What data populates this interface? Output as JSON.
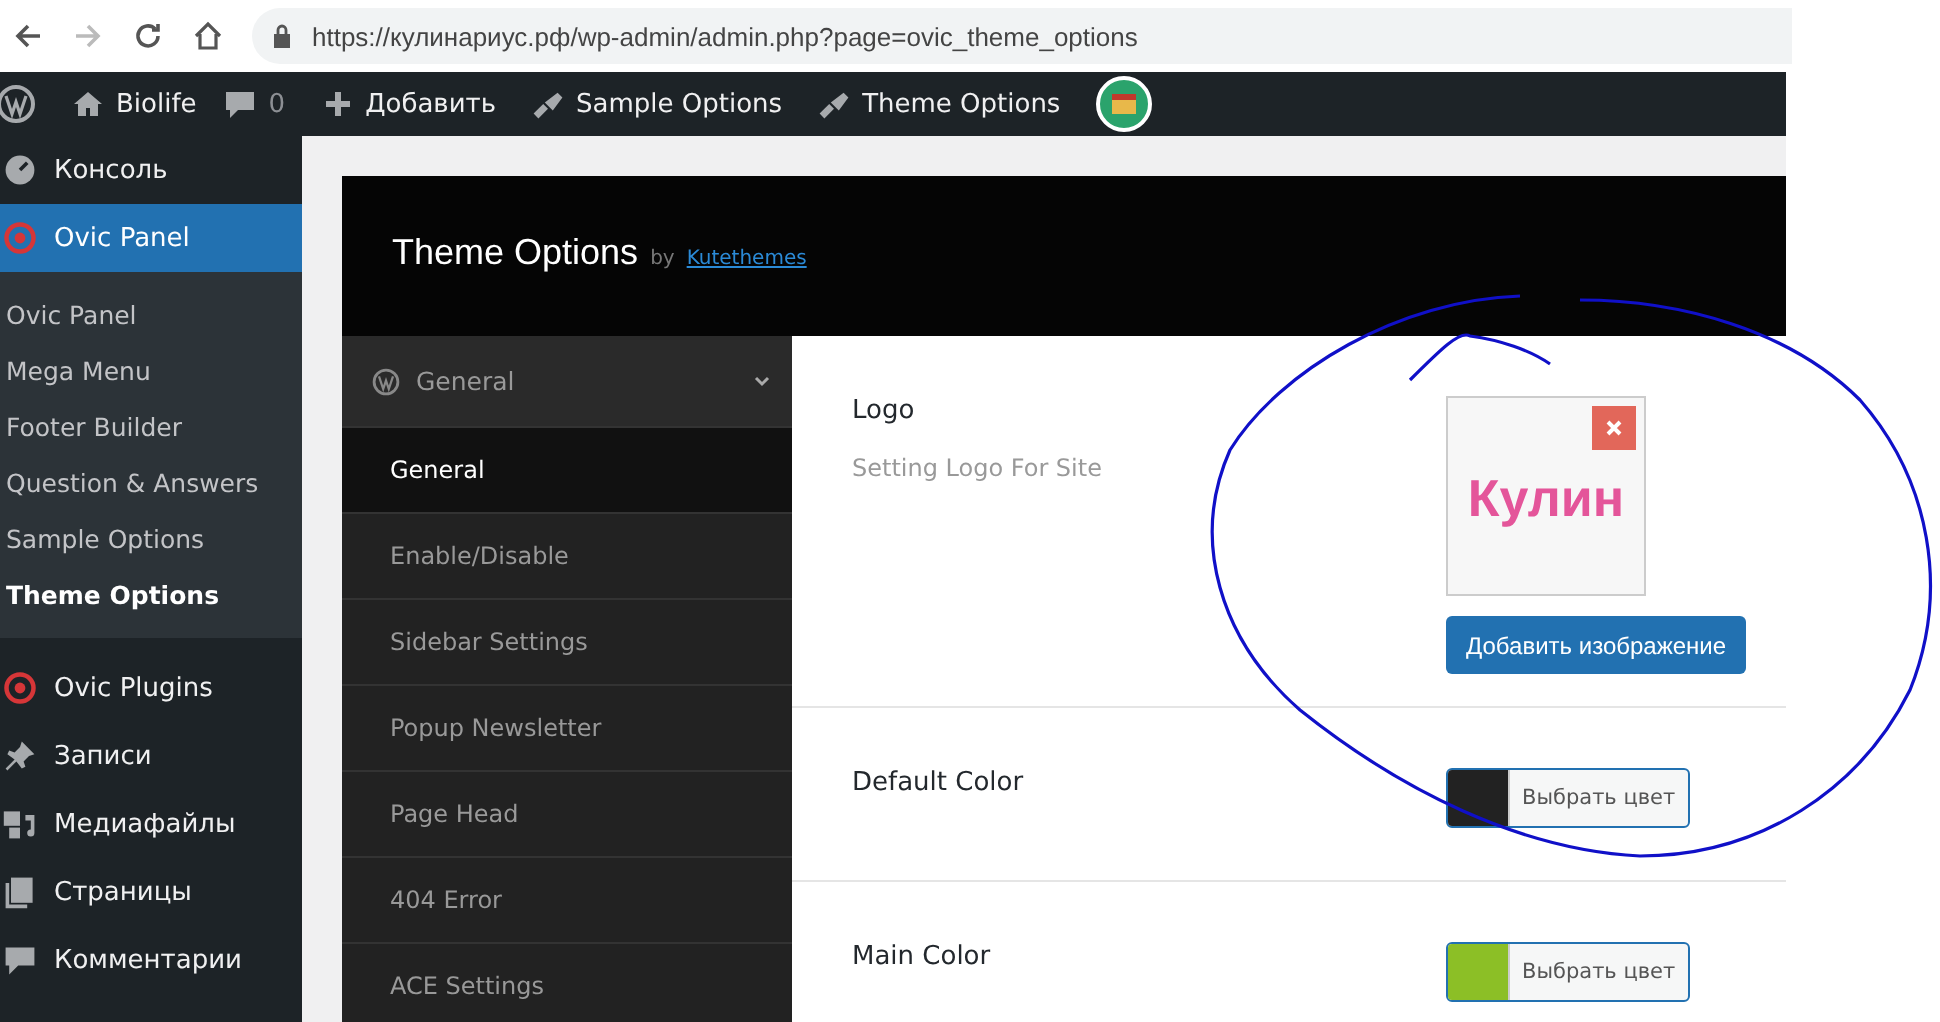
{
  "browser": {
    "url": "https://кулинариус.рф/wp-admin/admin.php?page=ovic_theme_options"
  },
  "admin_bar": [
    {
      "kind": "wp"
    },
    {
      "kind": "site",
      "label": "Biolife"
    },
    {
      "kind": "comments",
      "label": "0"
    },
    {
      "kind": "new",
      "label": "Добавить"
    },
    {
      "kind": "options",
      "label": "Sample Options"
    },
    {
      "kind": "options",
      "label": "Theme Options"
    },
    {
      "kind": "avatar"
    }
  ],
  "sidebar": {
    "items": [
      {
        "label": "Консоль",
        "selected": false
      },
      {
        "label": "Ovic Panel",
        "selected": true,
        "children": [
          {
            "label": "Ovic Panel",
            "selected": false
          },
          {
            "label": "Mega Menu",
            "selected": false
          },
          {
            "label": "Footer Builder",
            "selected": false
          },
          {
            "label": "Question & Answers",
            "selected": false
          },
          {
            "label": "Sample Options",
            "selected": false
          },
          {
            "label": "Theme Options",
            "selected": true
          }
        ]
      },
      {
        "label": "Ovic Plugins",
        "selected": false
      },
      {
        "label": "Записи",
        "selected": false
      },
      {
        "label": "Медиафайлы",
        "selected": false
      },
      {
        "label": "Страницы",
        "selected": false
      },
      {
        "label": "Комментарии",
        "selected": false
      }
    ]
  },
  "panel": {
    "title": "Theme Options",
    "by": "by",
    "author": "Kutethemes",
    "nav": {
      "group": "General",
      "expanded": true,
      "items": [
        {
          "label": "General",
          "selected": true
        },
        {
          "label": "Enable/Disable",
          "selected": false
        },
        {
          "label": "Sidebar Settings",
          "selected": false
        },
        {
          "label": "Popup Newsletter",
          "selected": false
        },
        {
          "label": "Page Head",
          "selected": false
        },
        {
          "label": "404 Error",
          "selected": false
        },
        {
          "label": "ACE Settings",
          "selected": false
        }
      ]
    },
    "fields": [
      {
        "kind": "image",
        "label": "Logo",
        "description": "Setting Logo For Site",
        "preview": "Кулин",
        "button": "Добавить изображение"
      },
      {
        "kind": "color",
        "label": "Default Color",
        "color": "#222222",
        "button": "Выбрать цвет"
      },
      {
        "kind": "color",
        "label": "Main Color",
        "color": "#8cbf26",
        "button": "Выбрать цвет"
      }
    ]
  }
}
